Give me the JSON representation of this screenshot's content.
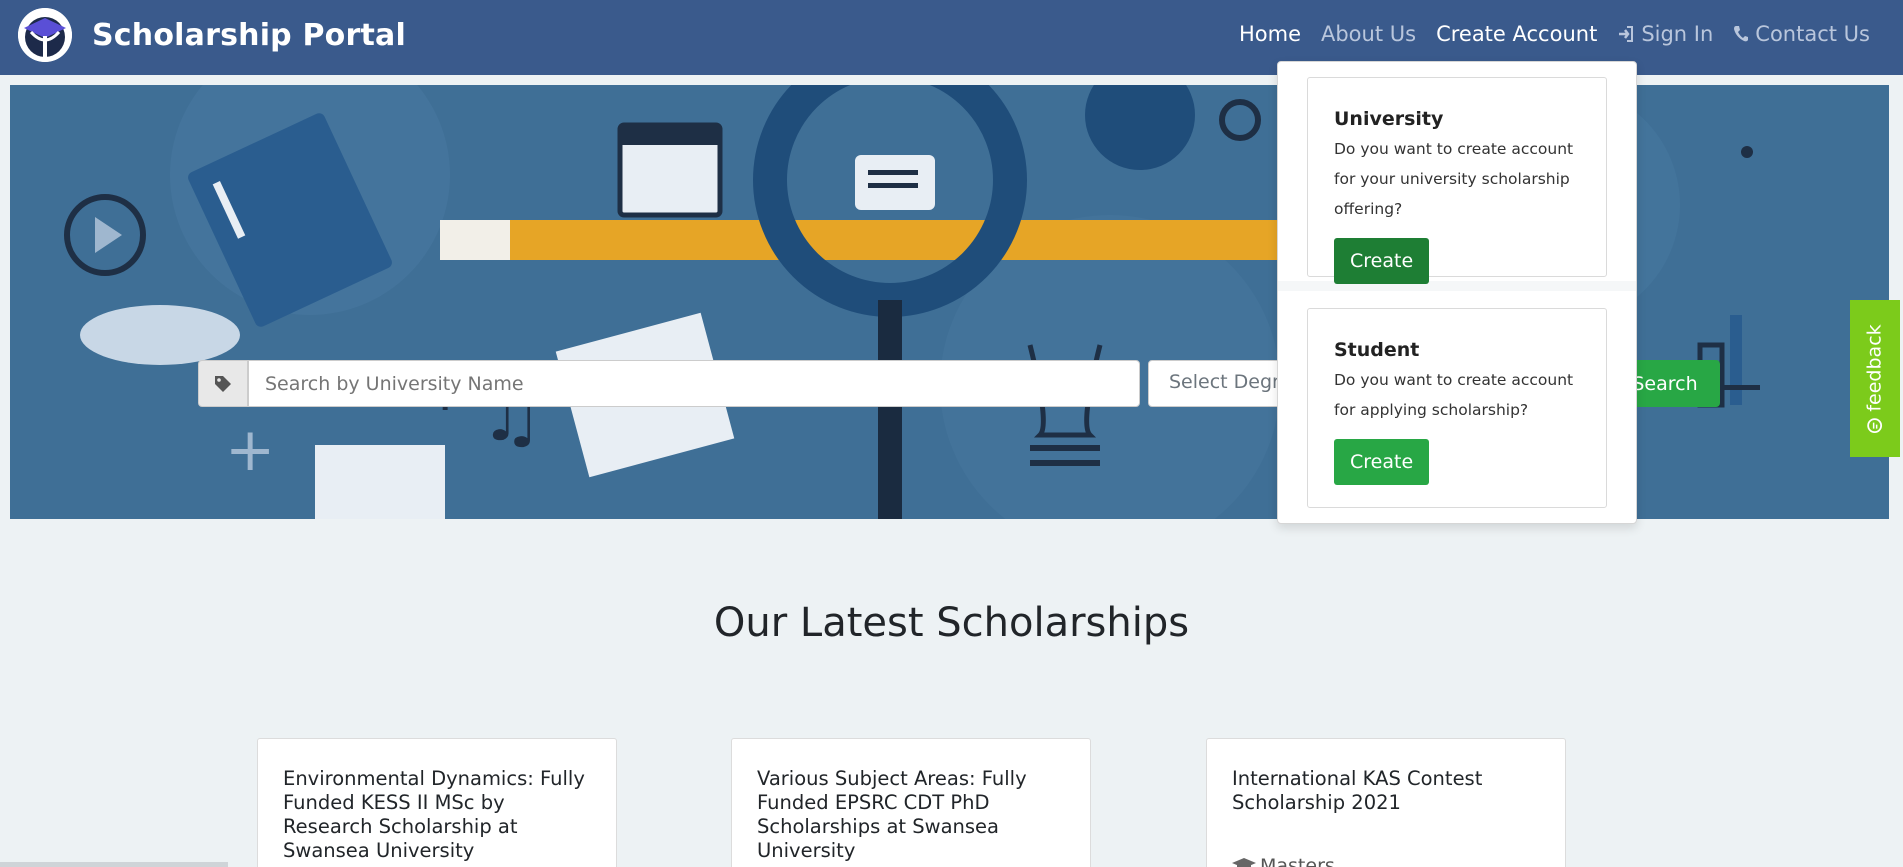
{
  "brand": {
    "title": "Scholarship Portal",
    "logo_icon": "graduation-cap-icon"
  },
  "nav": {
    "home": "Home",
    "about": "About Us",
    "create_account": "Create Account",
    "sign_in": "Sign In",
    "contact": "Contact Us"
  },
  "search": {
    "placeholder": "Search by University Name",
    "degree_placeholder": "Select Degree",
    "button": "Search",
    "tag_icon": "tag-icon"
  },
  "dropdown": {
    "university": {
      "title": "University",
      "description": "Do you want to create account for your university scholarship offering?",
      "button": "Create"
    },
    "student": {
      "title": "Student",
      "description": "Do you want to create account for applying scholarship?",
      "button": "Create"
    }
  },
  "feedback": {
    "label": "feedback"
  },
  "latest": {
    "title": "Our Latest Scholarships",
    "cards": [
      {
        "title": "Environmental Dynamics: Fully Funded KESS II MSc by Research Scholarship at Swansea University"
      },
      {
        "title": "Various Subject Areas: Fully Funded EPSRC CDT PhD Scholarships at Swansea University"
      },
      {
        "title": "International KAS Contest Scholarship 2021",
        "degree": "Masters"
      }
    ]
  },
  "colors": {
    "navbar": "#3a5a8c",
    "accent_green": "#28a745",
    "feedback_green": "#7ccb1b"
  }
}
